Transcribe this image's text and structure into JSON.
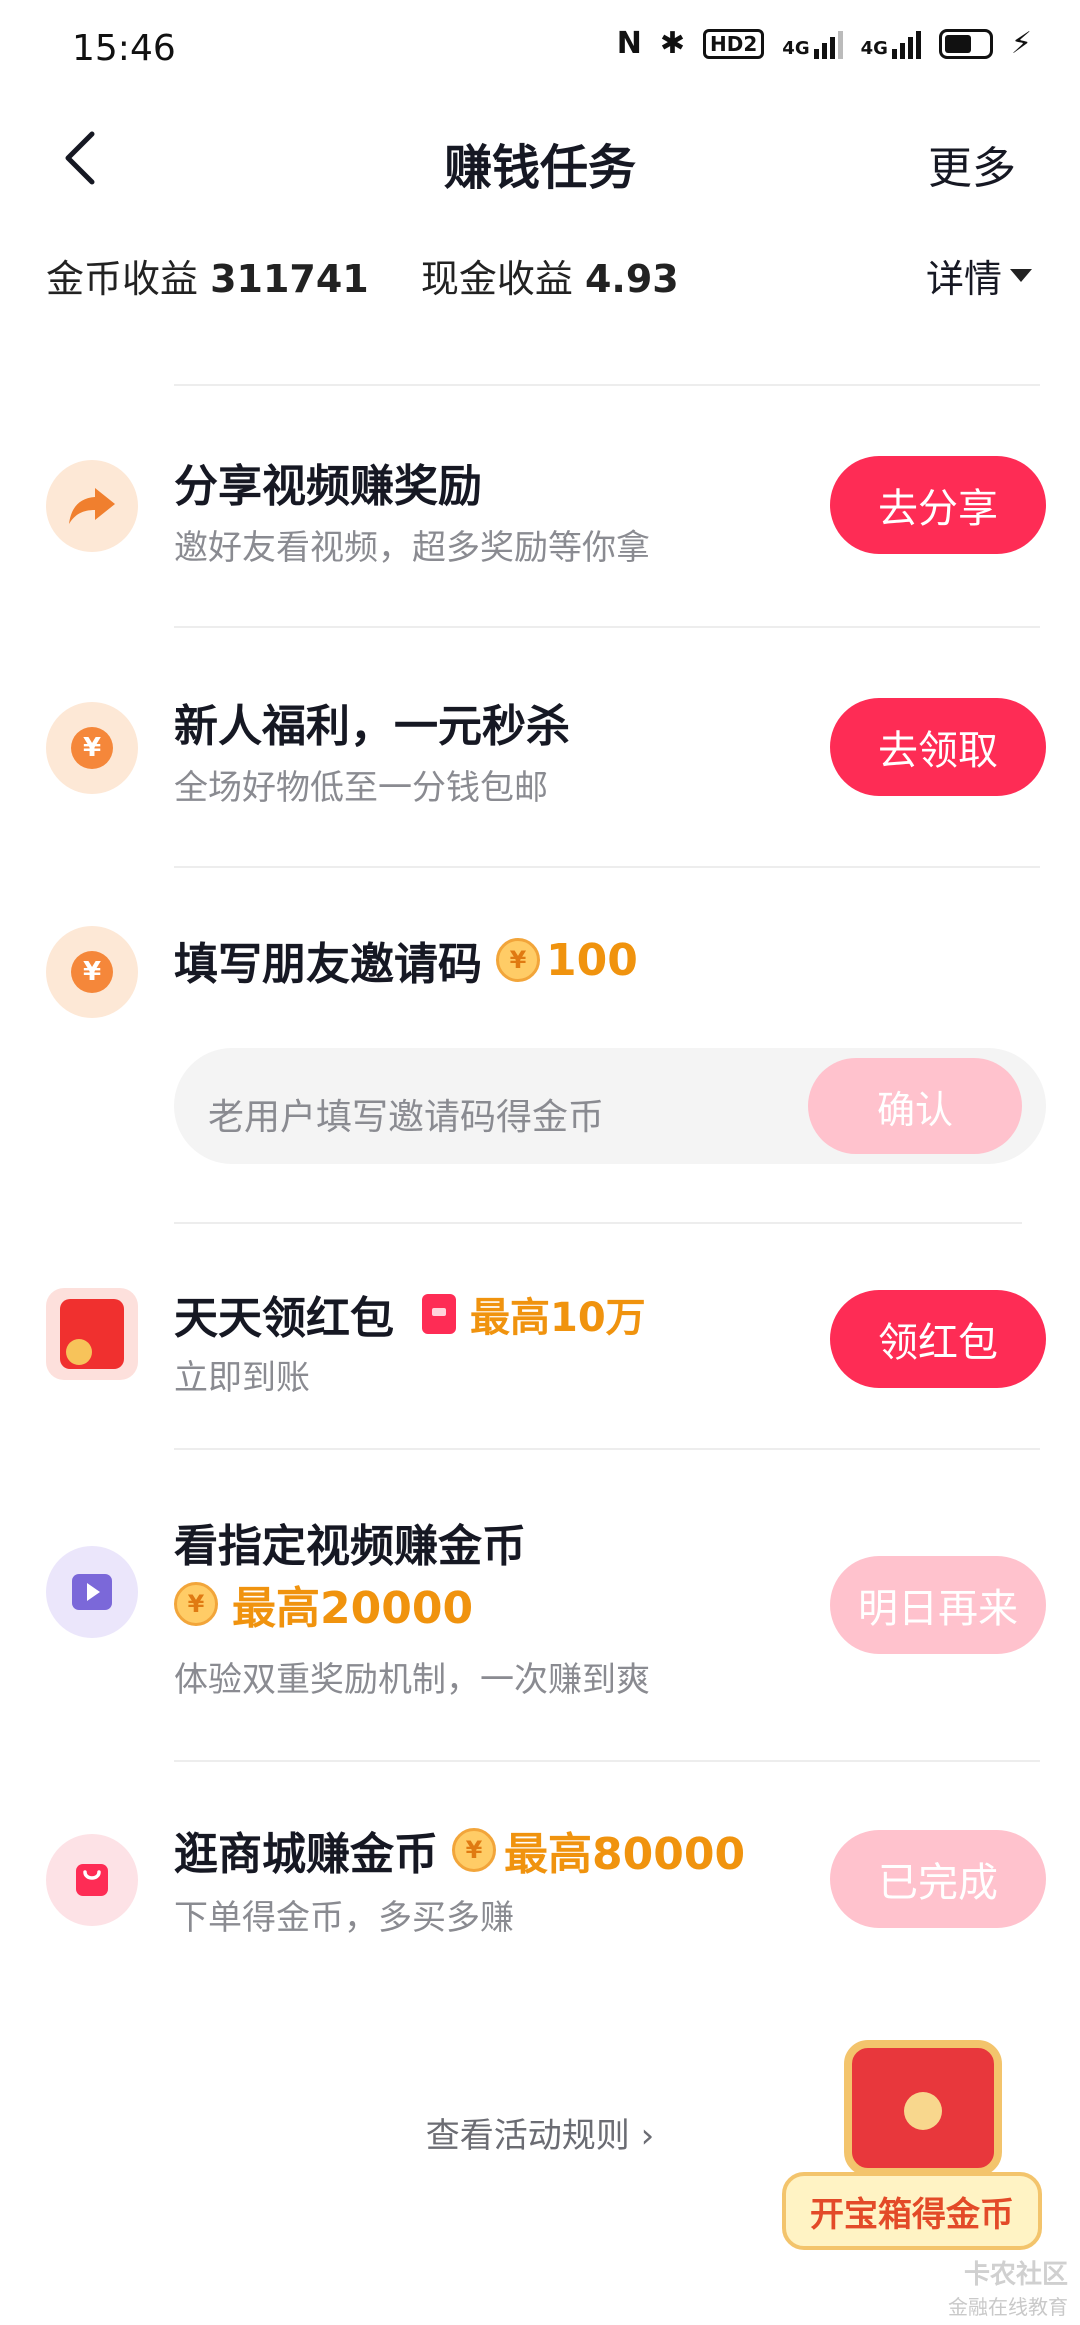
{
  "status_bar": {
    "time": "15:46",
    "hd": "HD2",
    "network1": "4G",
    "network2": "4G"
  },
  "header": {
    "title": "赚钱任务",
    "more": "更多"
  },
  "earnings": {
    "coin_label": "金币收益",
    "coin_value": "311741",
    "cash_label": "现金收益",
    "cash_value": "4.93",
    "detail": "详情"
  },
  "coin_symbol": "¥",
  "tasks": [
    {
      "title": "分享视频赚奖励",
      "desc": "邀好友看视频，超多奖励等你拿",
      "button": "去分享",
      "icon": "share-arrow-icon"
    },
    {
      "title": "新人福利，一元秒杀",
      "desc": "全场好物低至一分钱包邮",
      "button": "去领取",
      "icon": "yuan-coin-icon"
    },
    {
      "title": "填写朋友邀请码",
      "reward": "100",
      "input_placeholder": "老用户填写邀请码得金币",
      "button": "确认",
      "icon": "yuan-coin-icon"
    },
    {
      "title": "天天领红包",
      "reward": "最高10万",
      "desc": "立即到账",
      "button": "领红包",
      "icon": "red-envelope-icon"
    },
    {
      "title": "看指定视频赚金币",
      "reward": "最高20000",
      "desc": "体验双重奖励机制，一次赚到爽",
      "button": "明日再来",
      "icon": "video-play-icon"
    },
    {
      "title": "逛商城赚金币",
      "reward": "最高80000",
      "desc": "下单得金币，多买多赚",
      "button": "已完成",
      "icon": "shopping-bag-icon"
    }
  ],
  "footer": {
    "rules": "查看活动规则 ›",
    "chest_label": "开宝箱得金币"
  },
  "watermark": {
    "name": "卡农社区",
    "sub": "金融在线教育"
  },
  "colors": {
    "primary": "#fe2c55",
    "disabled": "#ffc2cd",
    "reward": "#f0930e"
  }
}
